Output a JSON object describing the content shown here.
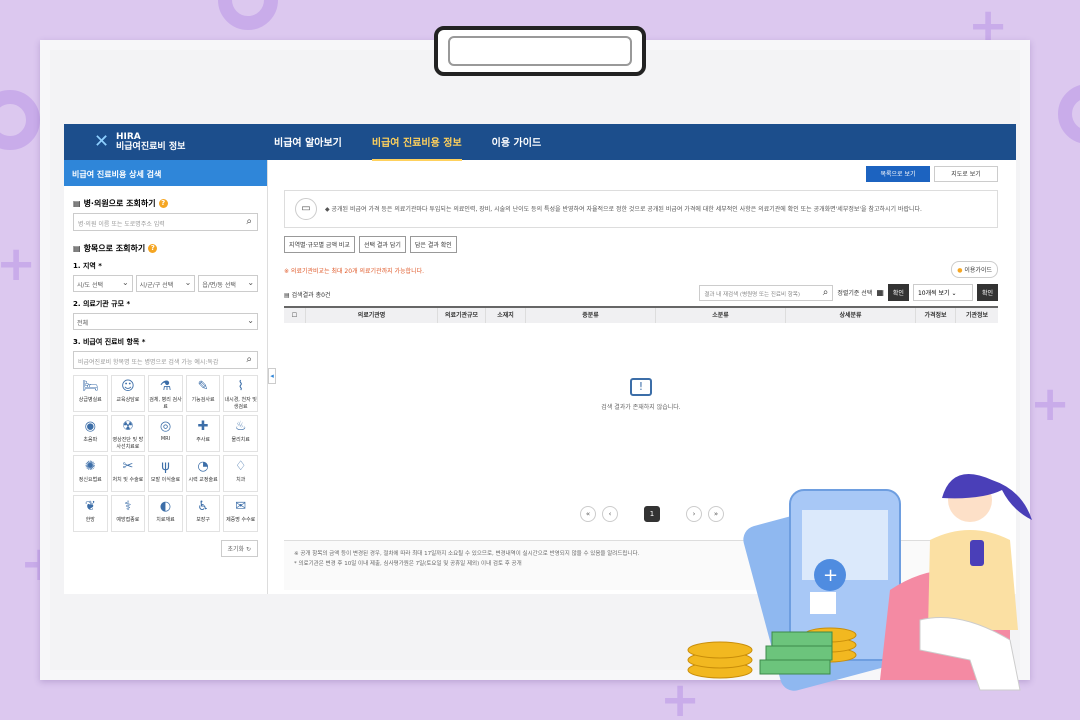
{
  "header": {
    "logo_line1": "HIRA",
    "logo_line2": "비급여진료비 정보",
    "nav": [
      {
        "label": "비급여 알아보기"
      },
      {
        "label": "비급여 진료비용 정보"
      },
      {
        "label": "이용 가이드"
      }
    ]
  },
  "sidebar": {
    "title": "비급여 진료비용 상세 검색",
    "hospital_section": "병·의원으로 조회하기",
    "hospital_placeholder": "병·의원 이름 또는 도로명주소 입력",
    "item_section": "항목으로 조회하기",
    "region_label": "1. 지역 *",
    "region_selects": [
      "시/도 선택",
      "시/군/구 선택",
      "읍/면/동 선택"
    ],
    "scale_label": "2. 의료기관 규모 *",
    "scale_value": "전체",
    "item_label": "3. 비급여 진료비 항목 *",
    "item_placeholder": "비급여진료비 항목명 또는 병명으로 검색 가능 예시:독감",
    "categories": [
      {
        "label": "상급병실료",
        "icon": "bed-icon"
      },
      {
        "label": "교육상담료",
        "icon": "counsel-icon"
      },
      {
        "label": "검체, 병리 검사료",
        "icon": "microscope-icon"
      },
      {
        "label": "기능검사료",
        "icon": "pen-icon"
      },
      {
        "label": "내시경, 천자 및 생검료",
        "icon": "endoscope-icon"
      },
      {
        "label": "초음파",
        "icon": "ultrasound-icon"
      },
      {
        "label": "영상진단 및 방사선치료료",
        "icon": "radiation-icon"
      },
      {
        "label": "MRI",
        "icon": "mri-icon"
      },
      {
        "label": "주사료",
        "icon": "syringe-icon"
      },
      {
        "label": "물리치료",
        "icon": "physio-icon"
      },
      {
        "label": "정신요법료",
        "icon": "brain-icon"
      },
      {
        "label": "처치 및 수술료",
        "icon": "surgery-icon"
      },
      {
        "label": "모발 이식술료",
        "icon": "hair-icon"
      },
      {
        "label": "시력 교정술료",
        "icon": "eye-icon"
      },
      {
        "label": "치과",
        "icon": "tooth-icon"
      },
      {
        "label": "한방",
        "icon": "hanbang-icon"
      },
      {
        "label": "예방접종료",
        "icon": "vaccine-icon"
      },
      {
        "label": "치료재료",
        "icon": "material-icon"
      },
      {
        "label": "보장구",
        "icon": "wheelchair-icon"
      },
      {
        "label": "제증명 수수료",
        "icon": "certificate-icon"
      }
    ],
    "reset_label": "초기화"
  },
  "main": {
    "view_list": "목록으로 보기",
    "view_map": "지도로 보기",
    "notice": "◆ 공개된 비급여 가격 등은 의료기관마다 투입되는 의료인력, 장비, 시술의 난이도 등의 특성을 반영하여 자율적으로 정한 것으로 공개된 비급여 가격에 대한 세부적인 사항은 의료기관에 확인 또는 공개화면'세부정보'을 참고하시기 바랍니다.",
    "tabs": [
      "지역별·규모별 금액 비교",
      "선택 결과 담기",
      "담은 결과 확인"
    ],
    "warning": "※ 의료기관비교는 최대 20개 의료기관까지 가능합니다.",
    "guide": "이용가이드",
    "count": "검색결과 총0건",
    "filter_placeholder": "결과 내 재검색 (병원명 또는 진료비 항목)",
    "sort_label": "정렬기준 선택",
    "confirm": "확인",
    "per_page": "10개씩 보기",
    "columns": [
      "의료기관명",
      "의료기관규모",
      "소재지",
      "중분류",
      "소분류",
      "상세분류",
      "가격정보",
      "기관정보"
    ],
    "empty": "검색 결과가 존재하지 않습니다.",
    "page": "1",
    "footnote1": "※ 공개 항목의 금액 등이 변경된 경우, 절차에 따라 최대 17일까지 소요될 수 있으므로, 변경내역이 실시간으로 반영되지 않을 수 있음을 알려드립니다.",
    "footnote2": "* 의료기관은 변경 후 10일 이내 제출, 심사평가원은 7일(토요일 및 공휴일 제외) 이내 검토 후 공개"
  }
}
